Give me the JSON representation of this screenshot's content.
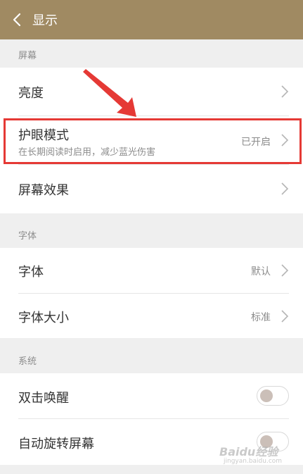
{
  "header": {
    "title": "显示",
    "back_icon": "back-chevron-icon",
    "background": "#a08a62"
  },
  "sections": {
    "screen": {
      "label": "屏幕",
      "brightness": {
        "title": "亮度"
      },
      "eye_mode": {
        "title": "护眼模式",
        "subtitle": "在长期阅读时启用，减少蓝光伤害",
        "value": "已开启"
      },
      "screen_effect": {
        "title": "屏幕效果"
      }
    },
    "font": {
      "label": "字体",
      "font": {
        "title": "字体",
        "value": "默认"
      },
      "font_size": {
        "title": "字体大小",
        "value": "标准"
      }
    },
    "system": {
      "label": "系统",
      "double_tap_wake": {
        "title": "双击唤醒",
        "enabled": false
      },
      "auto_rotate": {
        "title": "自动旋转屏幕",
        "enabled": false
      }
    }
  },
  "annotation": {
    "color": "#e53935"
  },
  "watermark": {
    "text": "Baidu经验",
    "sub": "jingyan.baidu.com"
  }
}
